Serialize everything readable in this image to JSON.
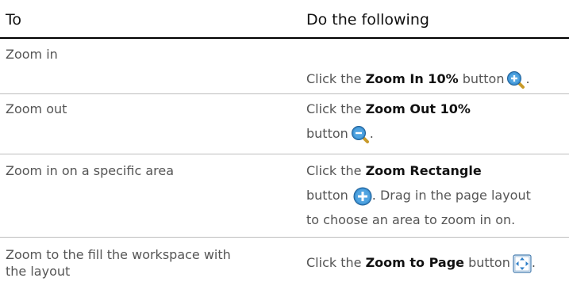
{
  "header": {
    "col1": "To",
    "col2": "Do the following"
  },
  "rows": [
    {
      "to": "Zoom in",
      "do_prefix": "Click the ",
      "do_bold": "Zoom In 10%",
      "do_suffix": " button",
      "icon": "zoom-in-icon"
    },
    {
      "to": "Zoom out",
      "do_prefix": "Click the ",
      "do_bold": "Zoom Out 10%",
      "do_line2": "button",
      "icon": "zoom-out-icon"
    },
    {
      "to": "Zoom in on a specific area",
      "do_prefix": "Click the ",
      "do_bold": "Zoom Rectangle",
      "do_line2": "button",
      "do_line2_suffix": ". Drag in the page layout",
      "do_line3": "to choose an area to zoom in on.",
      "icon": "zoom-rectangle-icon"
    },
    {
      "to_line1": "Zoom to the fill the workspace with",
      "to_line2": "the layout",
      "do_prefix": "Click the ",
      "do_bold": "Zoom to Page",
      "do_suffix": " button",
      "icon": "zoom-to-page-icon"
    }
  ],
  "period": "."
}
